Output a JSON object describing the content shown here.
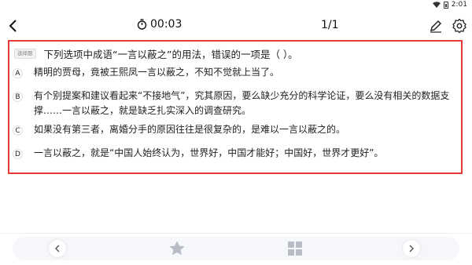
{
  "status_bar": {
    "time": "2:01"
  },
  "header": {
    "timer_value": "00:03",
    "page_counter": "1/1"
  },
  "question": {
    "type_badge": "选择题",
    "stem": "下列选项中成语“一言以蔽之”的用法，错误的一项是（ ）。",
    "options": [
      {
        "letter": "A",
        "text": "精明的贾母，竟被王熙凤一言以蔽之，不知不觉就上当了。"
      },
      {
        "letter": "B",
        "text": "有个别提案和建议看起来“不接地气”，究其原因，要么缺少充分的科学论证，要么没有相关的数据支撑……一言以蔽之，就是缺乏扎实深入的调查研究。"
      },
      {
        "letter": "C",
        "text": "如果没有第三者，离婚分手的原因往往是很复杂的，是难以一言以蔽之的。"
      },
      {
        "letter": "D",
        "text": "一言以蔽之，就是“中国人始终认为，世界好，中国才能好；中国好，世界才更好”。"
      }
    ]
  },
  "icons": {
    "back": "chevron-left-icon",
    "timer": "stopwatch-icon",
    "edit": "pencil-icon",
    "settings": "gear-icon",
    "prev": "chevron-left-icon",
    "favorite": "star-icon",
    "answer_sheet": "grid-icon",
    "next": "chevron-right-icon"
  },
  "colors": {
    "highlight_border": "#e53935",
    "icon_gray": "#b8bcc6"
  }
}
